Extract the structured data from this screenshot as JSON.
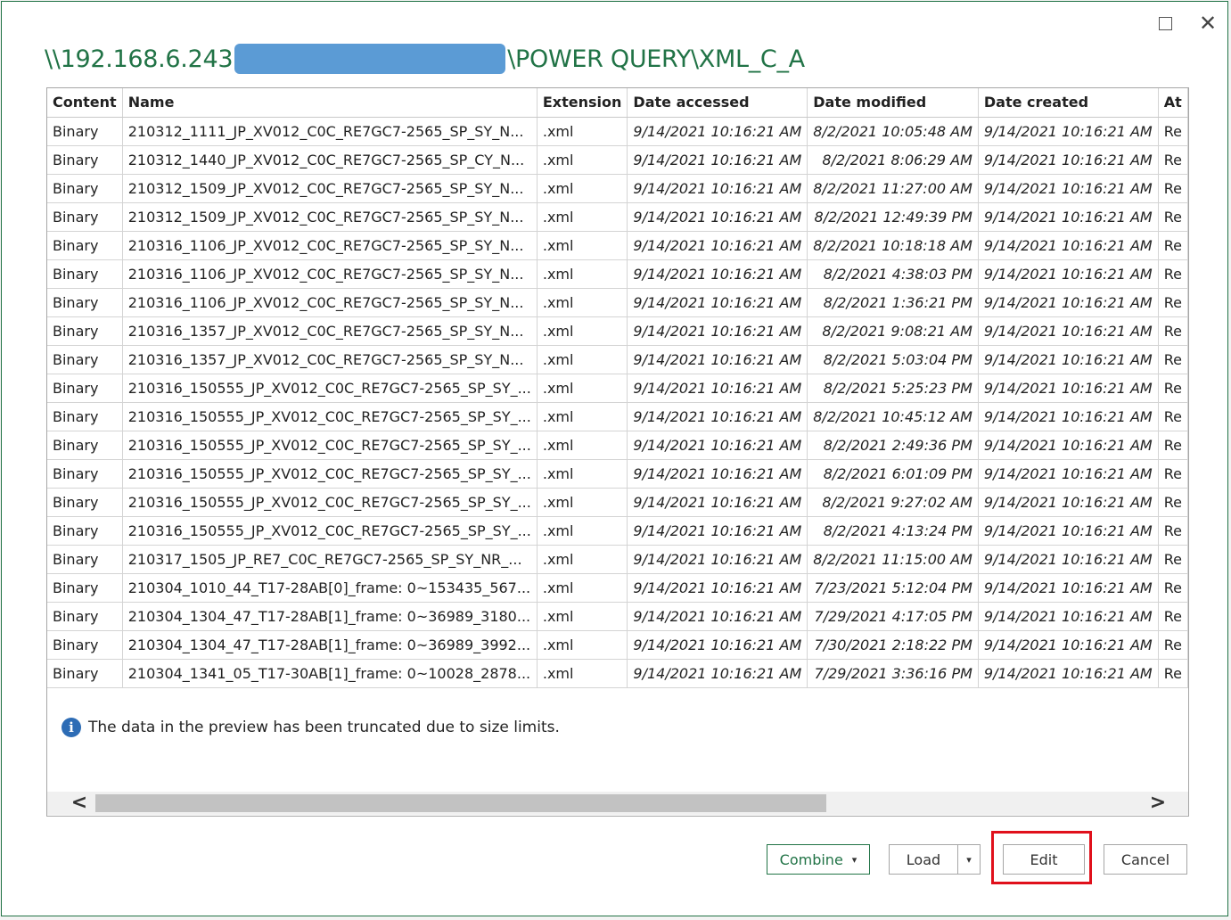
{
  "title": {
    "path_prefix": "\\\\192.168.6.243",
    "path_suffix": "\\POWER QUERY\\XML_C_A"
  },
  "window_controls": {
    "maximize": "maximize-icon",
    "close": "close-icon"
  },
  "table": {
    "columns": [
      "Content",
      "Name",
      "Extension",
      "Date accessed",
      "Date modified",
      "Date created",
      "At"
    ],
    "rows": [
      [
        "Binary",
        "210312_1111_JP_XV012_C0C_RE7GC7-2565_SP_SY_N...",
        ".xml",
        "9/14/2021 10:16:21 AM",
        "8/2/2021 10:05:48 AM",
        "9/14/2021 10:16:21 AM",
        "Re"
      ],
      [
        "Binary",
        "210312_1440_JP_XV012_C0C_RE7GC7-2565_SP_CY_N...",
        ".xml",
        "9/14/2021 10:16:21 AM",
        "8/2/2021 8:06:29 AM",
        "9/14/2021 10:16:21 AM",
        "Re"
      ],
      [
        "Binary",
        "210312_1509_JP_XV012_C0C_RE7GC7-2565_SP_SY_N...",
        ".xml",
        "9/14/2021 10:16:21 AM",
        "8/2/2021 11:27:00 AM",
        "9/14/2021 10:16:21 AM",
        "Re"
      ],
      [
        "Binary",
        "210312_1509_JP_XV012_C0C_RE7GC7-2565_SP_SY_N...",
        ".xml",
        "9/14/2021 10:16:21 AM",
        "8/2/2021 12:49:39 PM",
        "9/14/2021 10:16:21 AM",
        "Re"
      ],
      [
        "Binary",
        "210316_1106_JP_XV012_C0C_RE7GC7-2565_SP_SY_N...",
        ".xml",
        "9/14/2021 10:16:21 AM",
        "8/2/2021 10:18:18 AM",
        "9/14/2021 10:16:21 AM",
        "Re"
      ],
      [
        "Binary",
        "210316_1106_JP_XV012_C0C_RE7GC7-2565_SP_SY_N...",
        ".xml",
        "9/14/2021 10:16:21 AM",
        "8/2/2021 4:38:03 PM",
        "9/14/2021 10:16:21 AM",
        "Re"
      ],
      [
        "Binary",
        "210316_1106_JP_XV012_C0C_RE7GC7-2565_SP_SY_N...",
        ".xml",
        "9/14/2021 10:16:21 AM",
        "8/2/2021 1:36:21 PM",
        "9/14/2021 10:16:21 AM",
        "Re"
      ],
      [
        "Binary",
        "210316_1357_JP_XV012_C0C_RE7GC7-2565_SP_SY_N...",
        ".xml",
        "9/14/2021 10:16:21 AM",
        "8/2/2021 9:08:21 AM",
        "9/14/2021 10:16:21 AM",
        "Re"
      ],
      [
        "Binary",
        "210316_1357_JP_XV012_C0C_RE7GC7-2565_SP_SY_N...",
        ".xml",
        "9/14/2021 10:16:21 AM",
        "8/2/2021 5:03:04 PM",
        "9/14/2021 10:16:21 AM",
        "Re"
      ],
      [
        "Binary",
        "210316_150555_JP_XV012_C0C_RE7GC7-2565_SP_SY_...",
        ".xml",
        "9/14/2021 10:16:21 AM",
        "8/2/2021 5:25:23 PM",
        "9/14/2021 10:16:21 AM",
        "Re"
      ],
      [
        "Binary",
        "210316_150555_JP_XV012_C0C_RE7GC7-2565_SP_SY_...",
        ".xml",
        "9/14/2021 10:16:21 AM",
        "8/2/2021 10:45:12 AM",
        "9/14/2021 10:16:21 AM",
        "Re"
      ],
      [
        "Binary",
        "210316_150555_JP_XV012_C0C_RE7GC7-2565_SP_SY_...",
        ".xml",
        "9/14/2021 10:16:21 AM",
        "8/2/2021 2:49:36 PM",
        "9/14/2021 10:16:21 AM",
        "Re"
      ],
      [
        "Binary",
        "210316_150555_JP_XV012_C0C_RE7GC7-2565_SP_SY_...",
        ".xml",
        "9/14/2021 10:16:21 AM",
        "8/2/2021 6:01:09 PM",
        "9/14/2021 10:16:21 AM",
        "Re"
      ],
      [
        "Binary",
        "210316_150555_JP_XV012_C0C_RE7GC7-2565_SP_SY_...",
        ".xml",
        "9/14/2021 10:16:21 AM",
        "8/2/2021 9:27:02 AM",
        "9/14/2021 10:16:21 AM",
        "Re"
      ],
      [
        "Binary",
        "210316_150555_JP_XV012_C0C_RE7GC7-2565_SP_SY_...",
        ".xml",
        "9/14/2021 10:16:21 AM",
        "8/2/2021 4:13:24 PM",
        "9/14/2021 10:16:21 AM",
        "Re"
      ],
      [
        "Binary",
        "210317_1505_JP_RE7_C0C_RE7GC7-2565_SP_SY_NR_...",
        ".xml",
        "9/14/2021 10:16:21 AM",
        "8/2/2021 11:15:00 AM",
        "9/14/2021 10:16:21 AM",
        "Re"
      ],
      [
        "Binary",
        "210304_1010_44_T17-28AB[0]_frame: 0~153435_567...",
        ".xml",
        "9/14/2021 10:16:21 AM",
        "7/23/2021 5:12:04 PM",
        "9/14/2021 10:16:21 AM",
        "Re"
      ],
      [
        "Binary",
        "210304_1304_47_T17-28AB[1]_frame: 0~36989_3180...",
        ".xml",
        "9/14/2021 10:16:21 AM",
        "7/29/2021 4:17:05 PM",
        "9/14/2021 10:16:21 AM",
        "Re"
      ],
      [
        "Binary",
        "210304_1304_47_T17-28AB[1]_frame: 0~36989_3992...",
        ".xml",
        "9/14/2021 10:16:21 AM",
        "7/30/2021 2:18:22 PM",
        "9/14/2021 10:16:21 AM",
        "Re"
      ],
      [
        "Binary",
        "210304_1341_05_T17-30AB[1]_frame: 0~10028_2878...",
        ".xml",
        "9/14/2021 10:16:21 AM",
        "7/29/2021 3:36:16 PM",
        "9/14/2021 10:16:21 AM",
        "Re"
      ]
    ]
  },
  "info": {
    "icon": "info-icon",
    "message": "The data in the preview has been truncated due to size limits."
  },
  "scrollbar": {
    "left_arrow": "<",
    "right_arrow": ">"
  },
  "buttons": {
    "combine": "Combine",
    "load": "Load",
    "edit": "Edit",
    "cancel": "Cancel",
    "dropdown_caret": "▾"
  },
  "colors": {
    "accent_green": "#217346",
    "redaction_blue": "#5b9bd5",
    "highlight_red": "#e0101b"
  }
}
